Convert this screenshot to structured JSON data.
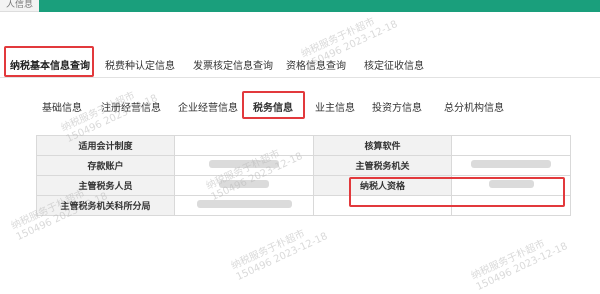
{
  "header": {
    "title": "人信息"
  },
  "main_tabs": [
    {
      "label": "纳税基本信息查询",
      "active": true
    },
    {
      "label": "税费种认定信息",
      "active": false
    },
    {
      "label": "发票核定信息查询",
      "active": false
    },
    {
      "label": "资格信息查询",
      "active": false
    },
    {
      "label": "核定征收信息",
      "active": false
    }
  ],
  "sub_tabs": [
    {
      "label": "基础信息",
      "active": false
    },
    {
      "label": "注册经营信息",
      "active": false
    },
    {
      "label": "企业经营信息",
      "active": false
    },
    {
      "label": "税务信息",
      "active": true
    },
    {
      "label": "业主信息",
      "active": false
    },
    {
      "label": "投资方信息",
      "active": false
    },
    {
      "label": "总分机构信息",
      "active": false
    }
  ],
  "tax_info": {
    "rows": [
      {
        "left_label": "适用会计制度",
        "right_label": "核算软件"
      },
      {
        "left_label": "存款账户",
        "right_label": "主管税务机关"
      },
      {
        "left_label": "主管税务人员",
        "right_label": "纳税人资格"
      },
      {
        "left_label": "主管税务机关科所分局",
        "right_label": ""
      }
    ]
  },
  "watermark": {
    "line1": "纳税服务于朴超市",
    "line2": "150496 2023-12-18"
  },
  "colors": {
    "accent": "#1a9f7c",
    "highlight": "#e2393c"
  }
}
